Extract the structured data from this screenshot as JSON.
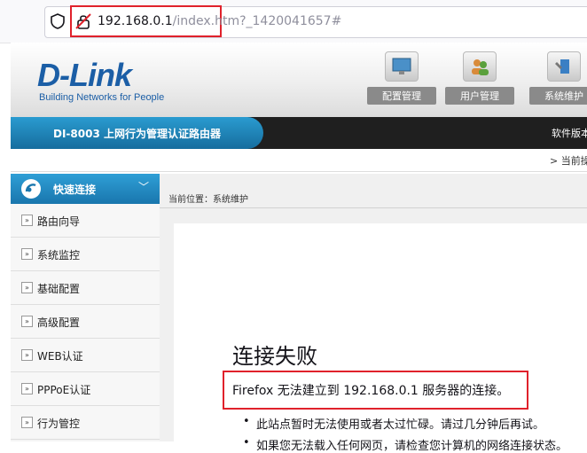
{
  "browser": {
    "url_host": "192.168.0.1",
    "url_path": "/index.htm?_1420041657#",
    "accent": "#e0212b"
  },
  "header": {
    "logo": "D-Link",
    "tagline": "Building Networks for People",
    "buttons": [
      {
        "label": "配置管理",
        "icon": "monitor-icon"
      },
      {
        "label": "用户管理",
        "icon": "users-icon"
      },
      {
        "label": "系统维护",
        "icon": "maintenance-icon"
      }
    ]
  },
  "modelbar": {
    "model": "DI-8003  上网行为管理认证路由器",
    "version": "软件版本"
  },
  "top_position": "> 当前操",
  "sidebar": {
    "title": "快速连接",
    "items": [
      {
        "label": "路由向导"
      },
      {
        "label": "系统监控"
      },
      {
        "label": "基础配置"
      },
      {
        "label": "高级配置"
      },
      {
        "label": "WEB认证"
      },
      {
        "label": "PPPoE认证"
      },
      {
        "label": "行为管控"
      }
    ]
  },
  "content": {
    "breadcrumb": "当前位置：系统维护",
    "error": {
      "title": "连接失败",
      "message": "Firefox 无法建立到 192.168.0.1 服务器的连接。",
      "bullet1": "此站点暂时无法使用或者太过忙碌。请过几分钟后再试。",
      "bullet2": "如果您无法载入任何网页，请检查您计算机的网络连接状态。"
    }
  }
}
